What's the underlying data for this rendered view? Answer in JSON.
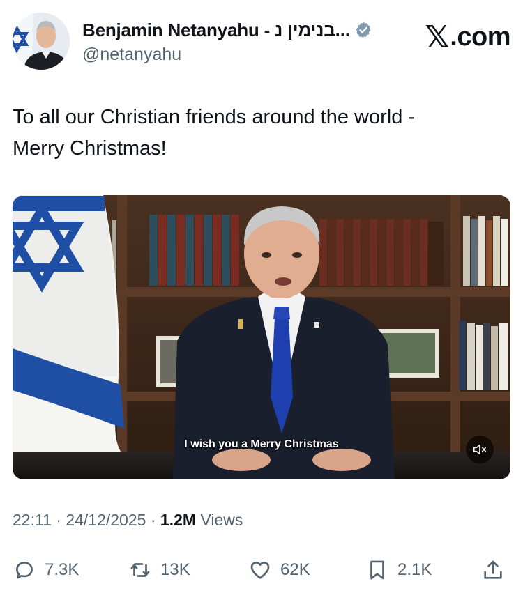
{
  "author": {
    "display_name": "Benjamin Netanyahu - בנימין נ...",
    "handle": "@netanyahu",
    "verified_icon": "verified-badge-icon"
  },
  "brand": {
    "logo_text": ".com",
    "logo_mark": "𝕏"
  },
  "tweet": {
    "text_line1": "To all our Christian friends around the world -",
    "text_line2": "Merry Christmas!"
  },
  "video": {
    "caption": "I wish you a Merry Christmas",
    "mute_icon": "volume-muted-icon"
  },
  "meta": {
    "time": "22:11",
    "separator1": " · ",
    "date": "24/12/2025",
    "separator2": " · ",
    "views_count": "1.2M",
    "views_label": " Views"
  },
  "actions": {
    "replies": "7.3K",
    "reposts": "13K",
    "likes": "62K",
    "bookmarks": "2.1K"
  },
  "colors": {
    "text_primary": "#0f1419",
    "text_secondary": "#536471",
    "verified": "#829aab",
    "flag_blue": "#1e4fa5"
  }
}
